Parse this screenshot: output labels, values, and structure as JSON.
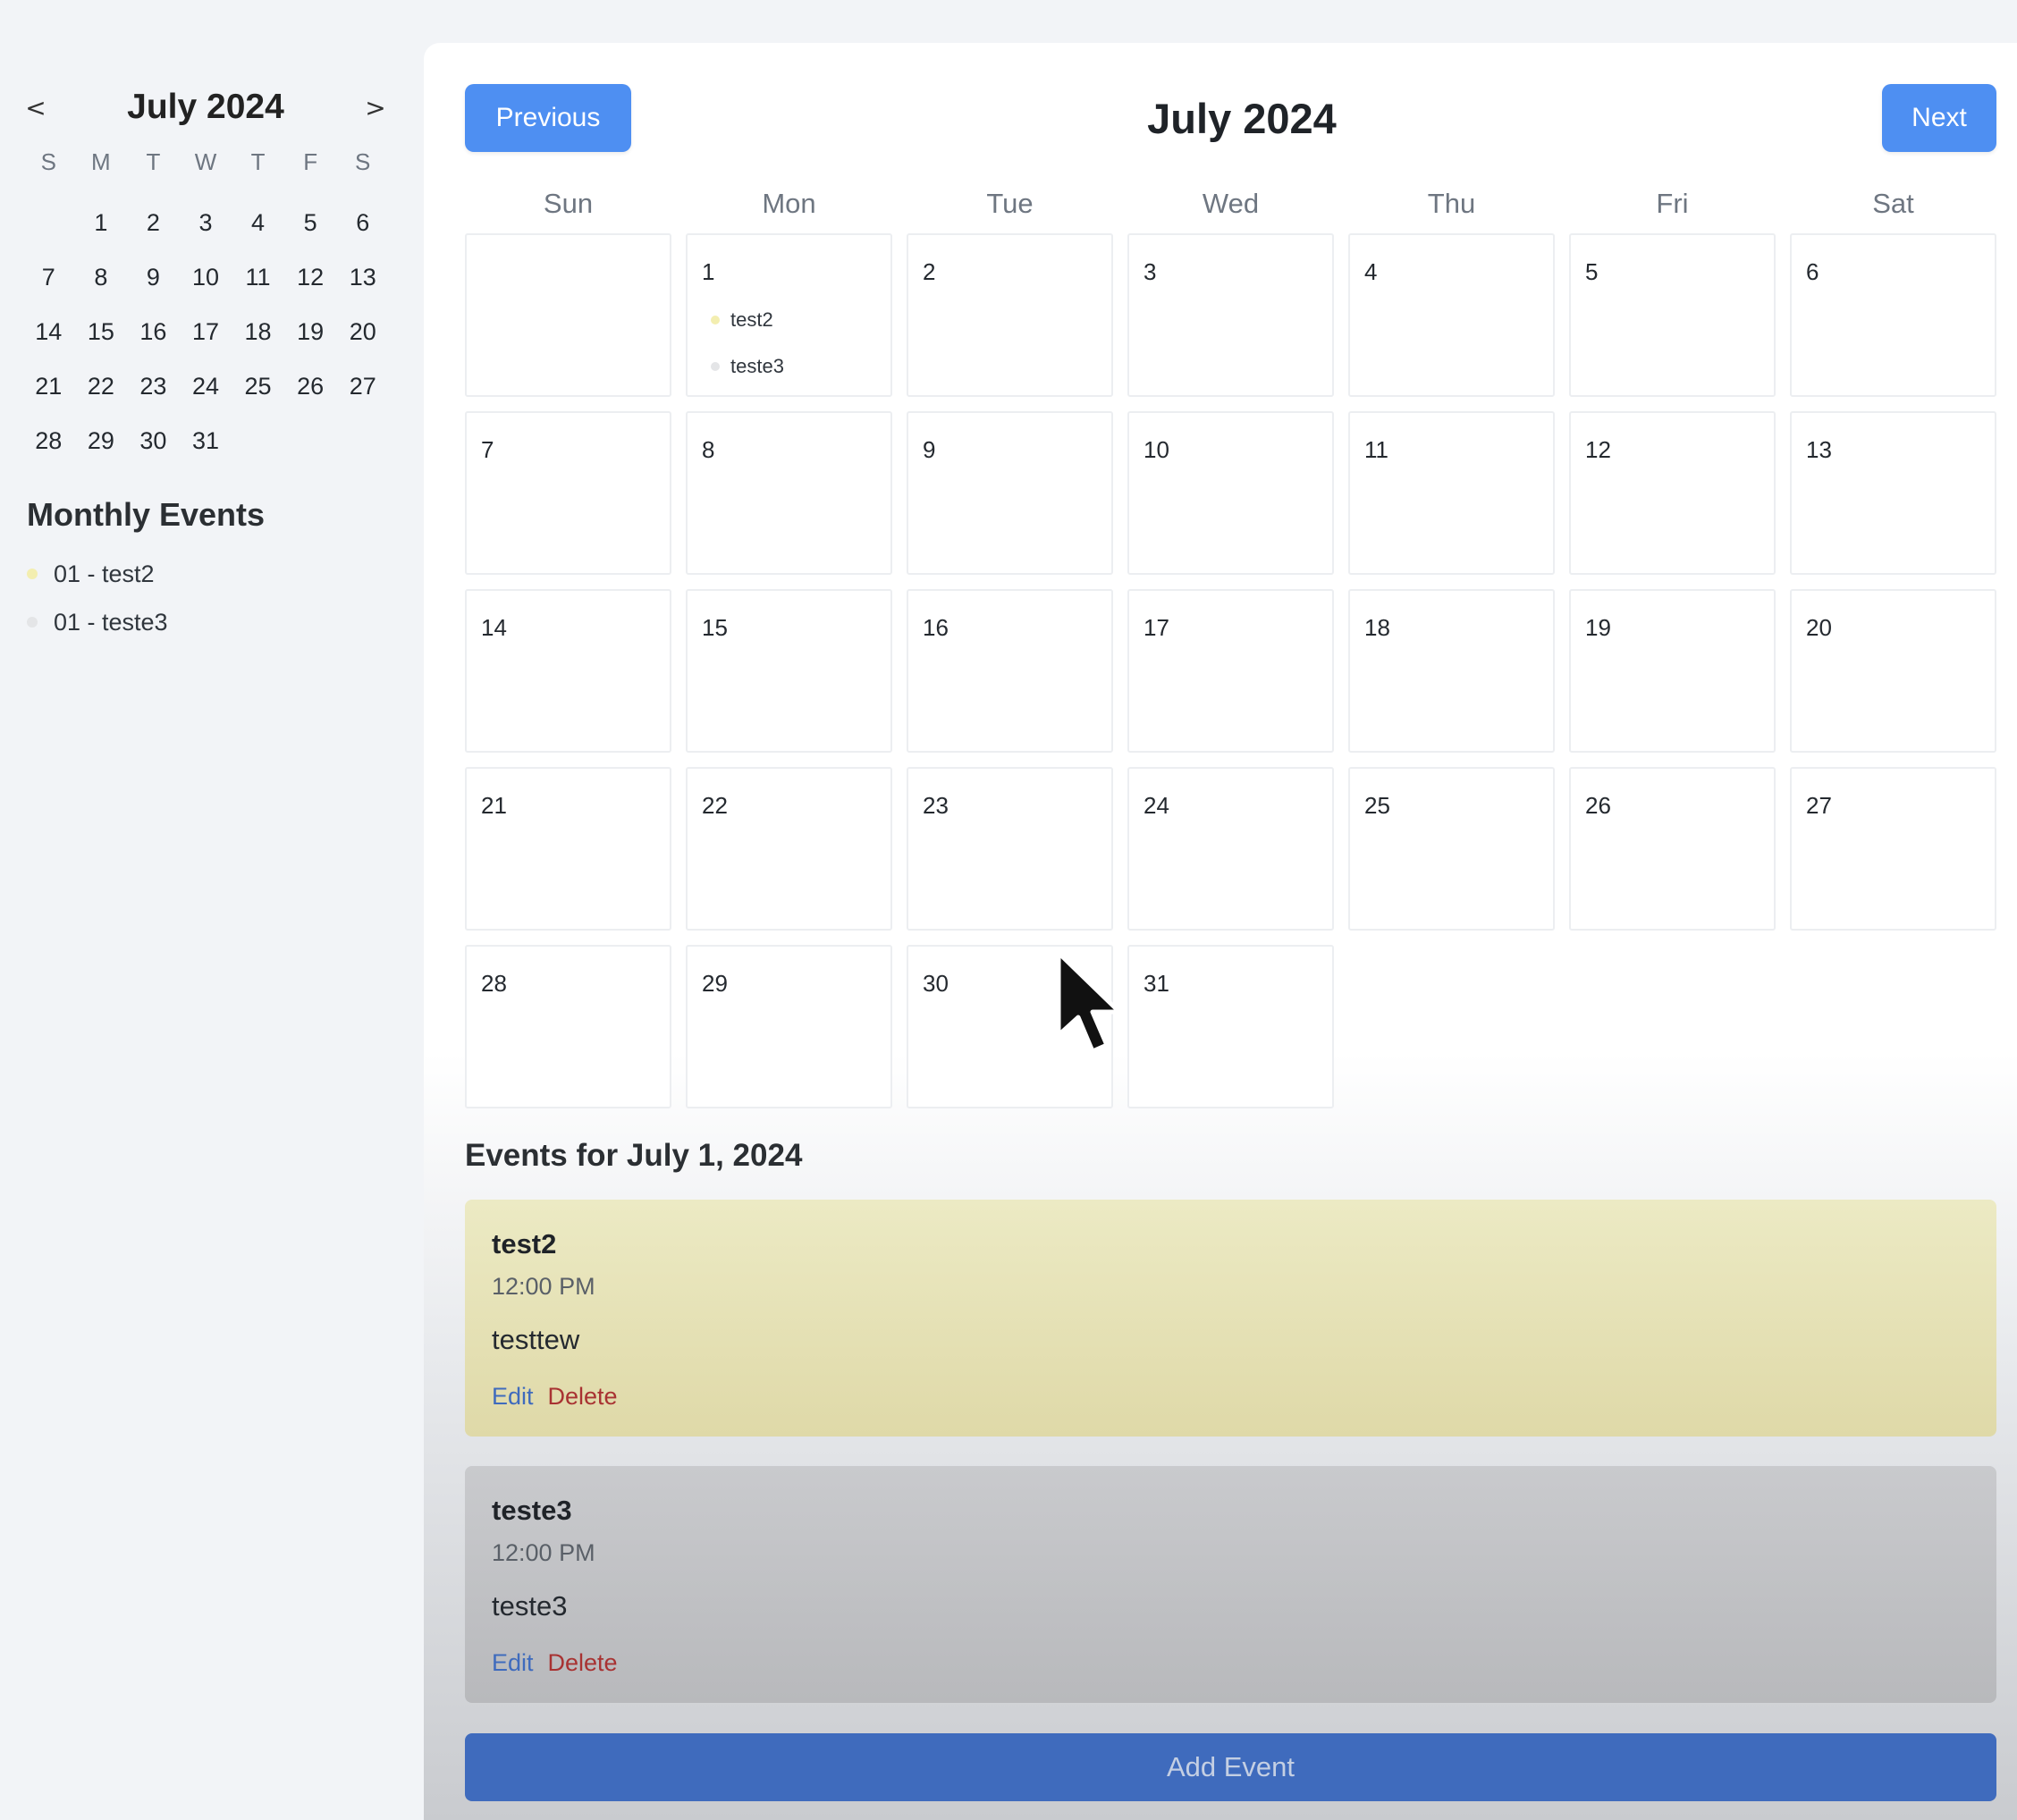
{
  "sidebar": {
    "prev_symbol": "<",
    "next_symbol": ">",
    "month_title": "July 2024",
    "weekday_initials": [
      "S",
      "M",
      "T",
      "W",
      "T",
      "F",
      "S"
    ],
    "leading_blanks": 1,
    "days": [
      "1",
      "2",
      "3",
      "4",
      "5",
      "6",
      "7",
      "8",
      "9",
      "10",
      "11",
      "12",
      "13",
      "14",
      "15",
      "16",
      "17",
      "18",
      "19",
      "20",
      "21",
      "22",
      "23",
      "24",
      "25",
      "26",
      "27",
      "28",
      "29",
      "30",
      "31"
    ],
    "monthly_events_title": "Monthly Events",
    "monthly_events": [
      {
        "label": "01 - test2",
        "color": "#f3eeb0"
      },
      {
        "label": "01 - teste3",
        "color": "#e4e5e7"
      }
    ]
  },
  "main": {
    "prev_label": "Previous",
    "next_label": "Next",
    "month_title": "July 2024",
    "weekdays": [
      "Sun",
      "Mon",
      "Tue",
      "Wed",
      "Thu",
      "Fri",
      "Sat"
    ],
    "leading_blanks": 1,
    "days": [
      "1",
      "2",
      "3",
      "4",
      "5",
      "6",
      "7",
      "8",
      "9",
      "10",
      "11",
      "12",
      "13",
      "14",
      "15",
      "16",
      "17",
      "18",
      "19",
      "20",
      "21",
      "22",
      "23",
      "24",
      "25",
      "26",
      "27",
      "28",
      "29",
      "30",
      "31"
    ],
    "day_events": {
      "1": [
        {
          "label": "test2",
          "color": "#f3eeb0"
        },
        {
          "label": "teste3",
          "color": "#e4e5e7"
        }
      ]
    },
    "events_heading": "Events for July 1, 2024",
    "events": [
      {
        "title": "test2",
        "time": "12:00 PM",
        "description": "testtew",
        "edit_label": "Edit",
        "delete_label": "Delete"
      },
      {
        "title": "teste3",
        "time": "12:00 PM",
        "description": "teste3",
        "edit_label": "Edit",
        "delete_label": "Delete"
      }
    ],
    "add_event_label": "Add Event"
  },
  "colors": {
    "accent": "#4e8ff2",
    "add_button": "#3f6bbd",
    "edit_link": "#3f6bbd",
    "delete_link": "#a83232",
    "event_yellow": "#eceac4",
    "event_gray": "#c9cacd"
  },
  "icons": {
    "cursor": "mouse-pointer-icon"
  }
}
